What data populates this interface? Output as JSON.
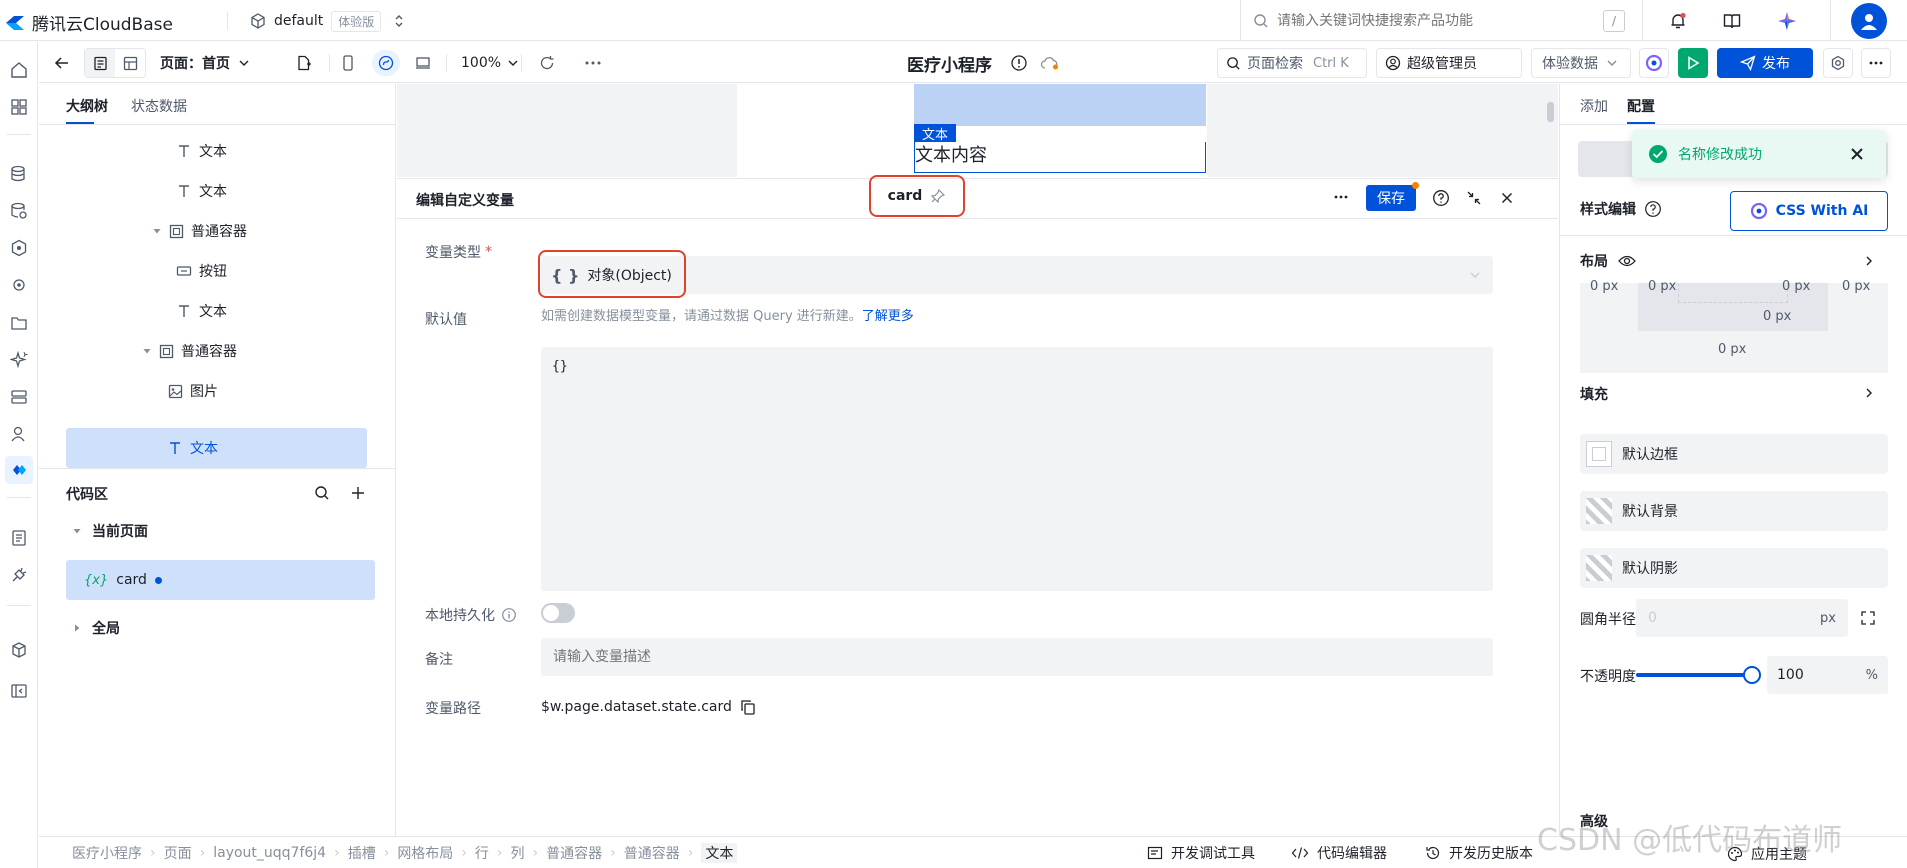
{
  "brand": {
    "logo_text": "腾讯云CloudBase",
    "env_name": "default",
    "env_badge": "体验版"
  },
  "search": {
    "placeholder": "请输入关键词快捷搜索产品功能",
    "shortcut": "/"
  },
  "toolbar": {
    "page_select": "页面：首页",
    "zoom": "100%",
    "title": "医疗小程序",
    "page_search": "页面检索",
    "page_search_shortcut": "Ctrl K",
    "role": "超级管理员",
    "data_mode": "体验数据",
    "publish": "发布"
  },
  "outline": {
    "tabs": [
      "大纲树",
      "状态数据"
    ],
    "nodes": [
      {
        "label": "文本",
        "icon": "text-icon"
      },
      {
        "label": "文本",
        "icon": "text-icon"
      },
      {
        "label": "普通容器",
        "icon": "container-icon"
      },
      {
        "label": "按钮",
        "icon": "button-icon"
      },
      {
        "label": "文本",
        "icon": "text-icon"
      },
      {
        "label": "普通容器",
        "icon": "container-icon"
      },
      {
        "label": "图片",
        "icon": "image-icon"
      },
      {
        "label": "文本",
        "icon": "text-icon"
      }
    ],
    "code_area": {
      "title": "代码区",
      "current_page": "当前页面",
      "var_prefix": "{x}",
      "var_name": "card",
      "global": "全局"
    }
  },
  "canvas": {
    "tag_label": "文本",
    "text": "文本内容"
  },
  "editor": {
    "title": "编辑自定义变量",
    "var_name": "card",
    "save": "保存",
    "type_label": "变量类型",
    "type_icon": "{ }",
    "type_value": "对象(Object)",
    "type_hint": "如需创建数据模型变量，请通过数据 Query 进行新建。",
    "learn_more": "了解更多",
    "default_label": "默认值",
    "default_value": "{}",
    "persist_label": "本地持久化",
    "note_label": "备注",
    "note_placeholder": "请输入变量描述",
    "path_label": "变量路径",
    "path_value": "$w.page.dataset.state.card"
  },
  "rpanel": {
    "tabs": [
      "添加",
      "配置"
    ],
    "toast": "名称修改成功",
    "style_edit": "样式编辑",
    "css_ai": "CSS With AI",
    "layout": "布局",
    "margin_values": [
      "0 px",
      "0 px",
      "0 px",
      "0 px",
      "0 px",
      "0 px"
    ],
    "fill": "填充",
    "default_border": "默认边框",
    "default_bg": "默认背景",
    "default_shadow": "默认阴影",
    "radius_label": "圆角半径",
    "radius_value": "0",
    "radius_unit": "px",
    "opacity_label": "不透明度",
    "opacity_value": "100",
    "opacity_unit": "%",
    "opacity_level": 1.0,
    "advanced": "高级"
  },
  "status": {
    "breadcrumb": [
      "医疗小程序",
      "页面",
      "layout_uqq7f6j4",
      "插槽",
      "网格布局",
      "行",
      "列",
      "普通容器",
      "普通容器",
      "文本"
    ],
    "dev_tools": "开发调试工具",
    "code_editor": "代码编辑器",
    "history": "开发历史版本",
    "apply_theme": "应用主题"
  },
  "watermark": "CSDN @低代码布道师",
  "colors": {
    "primary": "#0052d9",
    "success": "#00a870",
    "danger": "#e34d59"
  }
}
